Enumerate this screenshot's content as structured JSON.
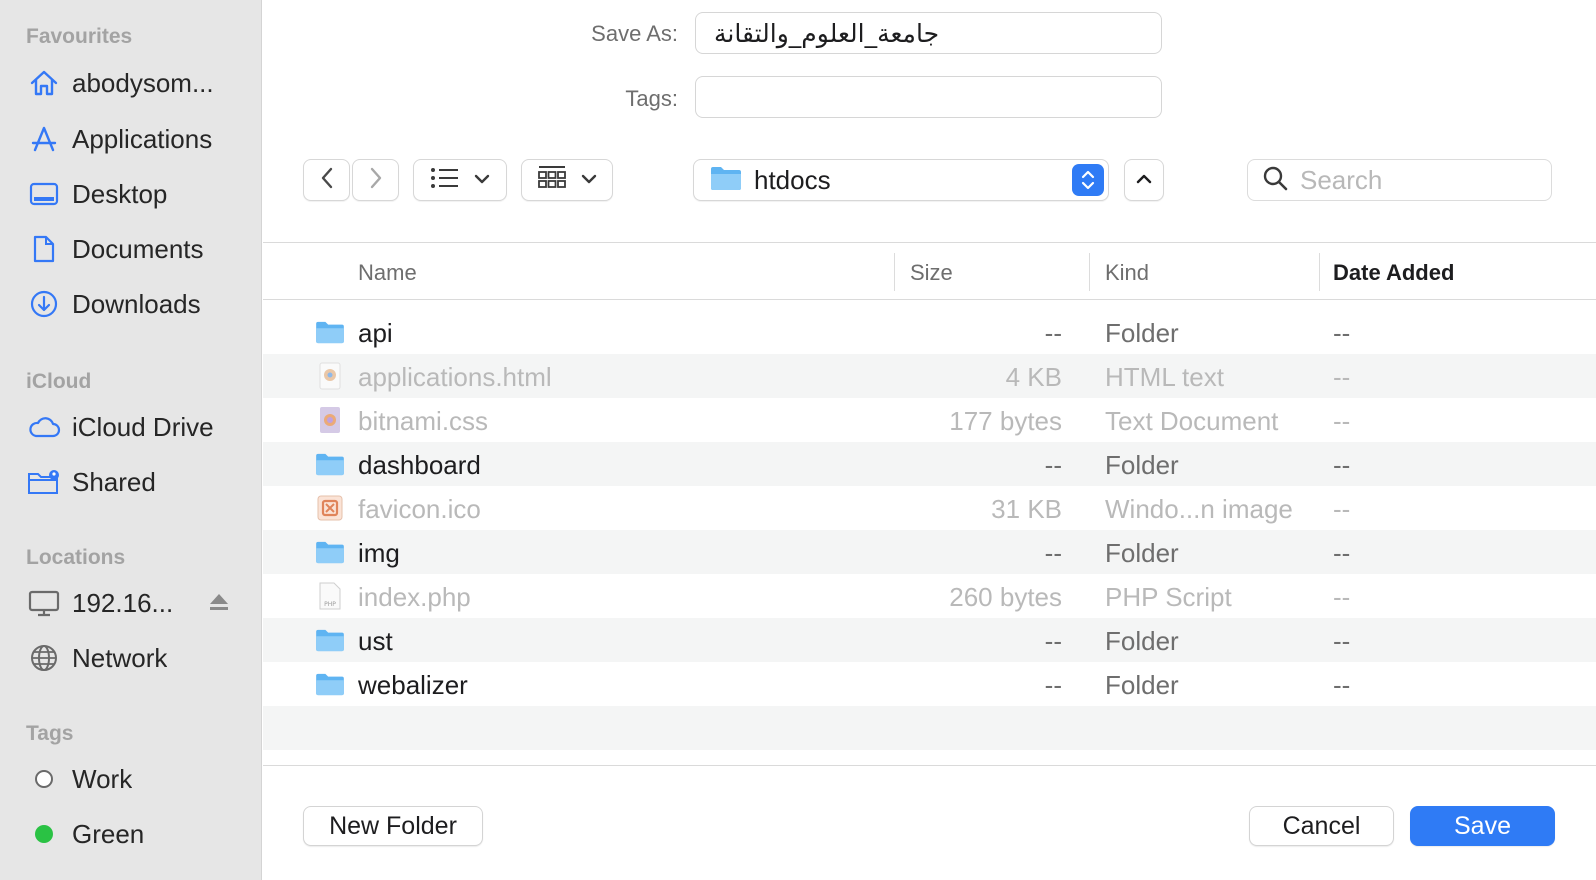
{
  "sidebar": {
    "favourites_title": "Favourites",
    "favourites": [
      {
        "label": "abodysom...",
        "icon": "home-icon"
      },
      {
        "label": "Applications",
        "icon": "applications-icon"
      },
      {
        "label": "Desktop",
        "icon": "desktop-icon"
      },
      {
        "label": "Documents",
        "icon": "document-icon"
      },
      {
        "label": "Downloads",
        "icon": "download-icon"
      }
    ],
    "icloud_title": "iCloud",
    "icloud": [
      {
        "label": "iCloud Drive",
        "icon": "cloud-icon"
      },
      {
        "label": "Shared",
        "icon": "shared-folder-icon"
      }
    ],
    "locations_title": "Locations",
    "locations": [
      {
        "label": "192.16...",
        "icon": "computer-icon"
      },
      {
        "label": "Network",
        "icon": "globe-icon"
      }
    ],
    "tags_title": "Tags",
    "tags": [
      {
        "label": "Work",
        "color": "#ffffff"
      },
      {
        "label": "Green",
        "color": "#2ac244"
      }
    ]
  },
  "form": {
    "save_as_label": "Save As:",
    "save_as_value": "جامعة_العلوم_والتقانة",
    "tags_label": "Tags:",
    "tags_value": ""
  },
  "toolbar": {
    "current_folder": "htdocs",
    "search_placeholder": "Search"
  },
  "table": {
    "columns": {
      "name": "Name",
      "size": "Size",
      "kind": "Kind",
      "date": "Date Added"
    },
    "rows": [
      {
        "name": "api",
        "size": "--",
        "kind": "Folder",
        "date": "--",
        "type": "folder",
        "enabled": true
      },
      {
        "name": "applications.html",
        "size": "4 KB",
        "kind": "HTML text",
        "date": "--",
        "type": "html",
        "enabled": false
      },
      {
        "name": "bitnami.css",
        "size": "177 bytes",
        "kind": "Text Document",
        "date": "--",
        "type": "css",
        "enabled": false
      },
      {
        "name": "dashboard",
        "size": "--",
        "kind": "Folder",
        "date": "--",
        "type": "folder",
        "enabled": true
      },
      {
        "name": "favicon.ico",
        "size": "31 KB",
        "kind": "Windo...n image",
        "date": "--",
        "type": "ico",
        "enabled": false
      },
      {
        "name": "img",
        "size": "--",
        "kind": "Folder",
        "date": "--",
        "type": "folder",
        "enabled": true
      },
      {
        "name": "index.php",
        "size": "260 bytes",
        "kind": "PHP Script",
        "date": "--",
        "type": "php",
        "enabled": false
      },
      {
        "name": "ust",
        "size": "--",
        "kind": "Folder",
        "date": "--",
        "type": "folder",
        "enabled": true
      },
      {
        "name": "webalizer",
        "size": "--",
        "kind": "Folder",
        "date": "--",
        "type": "folder",
        "enabled": true
      }
    ]
  },
  "buttons": {
    "new_folder": "New Folder",
    "cancel": "Cancel",
    "save": "Save"
  },
  "colors": {
    "accent": "#2f7bf5",
    "sidebar_icon": "#3478f6"
  }
}
